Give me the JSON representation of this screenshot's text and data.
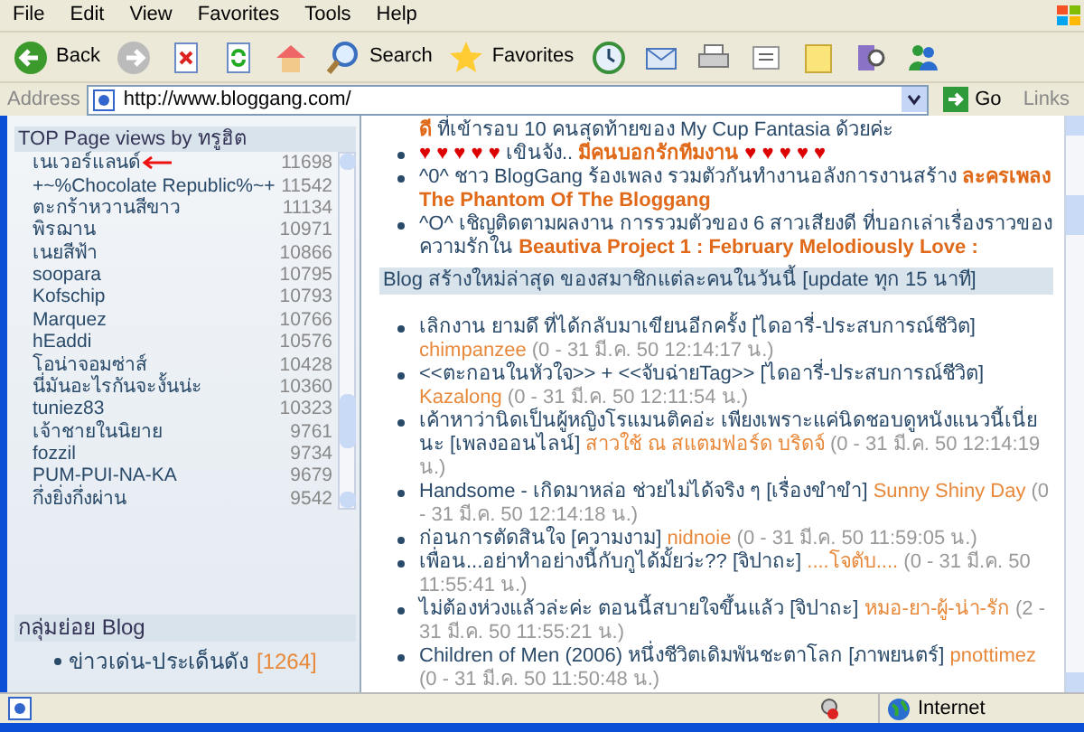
{
  "menu": [
    "File",
    "Edit",
    "View",
    "Favorites",
    "Tools",
    "Help"
  ],
  "toolbar": [
    {
      "kind": "back",
      "label": "Back"
    },
    {
      "kind": "forward"
    },
    {
      "kind": "stop"
    },
    {
      "kind": "refresh"
    },
    {
      "kind": "home"
    },
    {
      "kind": "search",
      "label": "Search"
    },
    {
      "kind": "favorites",
      "label": "Favorites"
    },
    {
      "kind": "history"
    },
    {
      "kind": "mail"
    },
    {
      "kind": "print"
    },
    {
      "kind": "edit"
    },
    {
      "kind": "note"
    },
    {
      "kind": "research"
    },
    {
      "kind": "messenger"
    }
  ],
  "address": {
    "label": "Address",
    "value": "http://www.bloggang.com/",
    "go": "Go",
    "links": "Links"
  },
  "top_views": {
    "title": "TOP Page views by ทรูฮิต",
    "items": [
      {
        "name": "เนเวอร์แลนด์",
        "count": "11698"
      },
      {
        "name": "+~%Chocolate Republic%~+",
        "count": "11542"
      },
      {
        "name": "ตะกร้าหวานสีขาว",
        "count": "11134"
      },
      {
        "name": "พิรฌาน",
        "count": "10971"
      },
      {
        "name": "เนยสีฟ้า",
        "count": "10866"
      },
      {
        "name": "soopara",
        "count": "10795"
      },
      {
        "name": "Kofschip",
        "count": "10793"
      },
      {
        "name": "Marquez",
        "count": "10766"
      },
      {
        "name": "hEaddi",
        "count": "10576"
      },
      {
        "name": "โอน่าจอมซ่าส์",
        "count": "10428"
      },
      {
        "name": "นี่มันอะไรกันจะงั้นน่ะ",
        "count": "10360"
      },
      {
        "name": "tuniez83",
        "count": "10323"
      },
      {
        "name": "เจ้าชายในนิยาย",
        "count": "9761"
      },
      {
        "name": "fozzil",
        "count": "9734"
      },
      {
        "name": "PUM-PUI-NA-KA",
        "count": "9679"
      },
      {
        "name": "กึ่งยิ่งกึ่งผ่าน",
        "count": "9542"
      }
    ]
  },
  "groups": {
    "title": "กลุ่มย่อย Blog",
    "items": [
      {
        "name": "ข่าวเด่น-ประเด็นดัง",
        "count": "[1264]"
      }
    ]
  },
  "news": [
    {
      "bullet": false,
      "parts": [
        {
          "kind": "highlight",
          "text": "ดี"
        },
        {
          "kind": "normal",
          "text": " ที่เข้ารอบ 10 คนสุดท้ายของ My Cup Fantasia ด้วยค่ะ"
        }
      ]
    },
    {
      "bullet": true,
      "parts": [
        {
          "kind": "hearts",
          "text": "♥ ♥ ♥ ♥ ♥"
        },
        {
          "kind": "normal",
          "text": " เขินจัง.. "
        },
        {
          "kind": "highlight",
          "text": "มีคนบอกรักทีมงาน"
        },
        {
          "kind": "hearts",
          "text": " ♥ ♥ ♥ ♥ ♥"
        }
      ]
    },
    {
      "bullet": true,
      "parts": [
        {
          "kind": "normal",
          "text": "^0^ ชาว BlogGang ร้องเพลง รวมตัวกันทำงานอลังการงานสร้าง "
        },
        {
          "kind": "highlight",
          "text": "ละครเพลง The Phantom Of The Bloggang"
        }
      ]
    },
    {
      "bullet": true,
      "parts": [
        {
          "kind": "normal",
          "text": "^O^ เชิญติดตามผลงาน การรวมตัวของ 6 สาวเสียงดี ที่บอกเล่าเรื่องราวของความรักใน "
        },
        {
          "kind": "highlight",
          "text": "Beautiva Project 1 : February Melodiously Love :"
        }
      ]
    }
  ],
  "new_blogs": {
    "title": "Blog สร้างใหม่ล่าสุด ของสมาชิกแต่ละคนในวันนี้ [update ทุก 15 นาที]",
    "items": [
      {
        "title": "เลิกงาน ยามดึ ที่ได้กลับมาเขียนอีกครั้ง",
        "category": "[ไดอารี่-ประสบการณ์ชีวิต]",
        "author": "chimpanzee",
        "time": "(0 - 31 มี.ค. 50 12:14:17 น.)"
      },
      {
        "title": "<<ตะกอนในหัวใจ>> + <<จับฉ่ายTag>>",
        "category": "[ไดอารี่-ประสบการณ์ชีวิต]",
        "author": "Kazalong",
        "time": "(0 - 31 มี.ค. 50 12:11:54 น.)"
      },
      {
        "title": "เค้าหาว่านิดเป็นผู้หญิงโรแมนติคอ่ะ เพียงเพราะแค่นิดชอบดูหนังแนวนี้เนี่ยนะ",
        "category": "[เพลงออนไลน์]",
        "author": "สาวใช้ ณ สแตมฟอร์ด บริดจ์",
        "time": "(0 - 31 มี.ค. 50 12:14:19 น.)"
      },
      {
        "title": "Handsome - เกิดมาหล่อ ช่วยไม่ได้จริง ๆ",
        "category": "[เรื่องขำขำ]",
        "author": "Sunny Shiny Day",
        "time": "(0 - 31 มี.ค. 50 12:14:18 น.)"
      },
      {
        "title": "ก่อนการตัดสินใจ",
        "category": "[ความงาม]",
        "author": "nidnoie",
        "time": "(0 - 31 มี.ค. 50 11:59:05 น.)"
      },
      {
        "title": "เพื่อน...อย่าทำอย่างนี้กับกูได้มั้ยว่ะ??",
        "category": "[จิปาถะ]",
        "author": "....โจตับ....",
        "time": "(0 - 31 มี.ค. 50 11:55:41 น.)"
      },
      {
        "title": "ไม่ต้องห่วงแล้วล่ะค่ะ ตอนนี้สบายใจขึ้นแล้ว",
        "category": "[จิปาถะ]",
        "author": "หมอ-ยา-ผู้-น่า-รัก",
        "time": "(2 - 31 มี.ค. 50 11:55:21 น.)"
      },
      {
        "title": "Children of Men (2006) หนึ่งชีวิตเดิมพันชะตาโลก",
        "category": "[ภาพยนตร์]",
        "author": "pnottimez",
        "time": "(0 - 31 มี.ค. 50 11:50:48 น.)"
      }
    ]
  },
  "status": {
    "zone": "Internet"
  }
}
